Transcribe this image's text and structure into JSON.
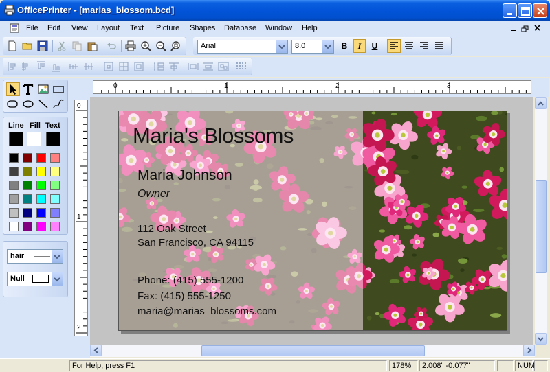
{
  "window": {
    "title": "OfficePrinter - [marias_blossom.bcd]",
    "icon": "printer-app-icon"
  },
  "menu": {
    "items": [
      "File",
      "Edit",
      "View",
      "Layout",
      "Text",
      "Picture",
      "Shapes",
      "Database",
      "Window",
      "Help"
    ]
  },
  "toolbar": {
    "font_name": "Arial",
    "font_size": "8.0",
    "bold_label": "B",
    "italic_label": "I",
    "underline_label": "U",
    "italic_active": true,
    "align_active": "left"
  },
  "tools": {
    "line_label": "Line",
    "fill_label": "Fill",
    "text_label": "Text",
    "line_color": "#000000",
    "fill_color": "#ffffff",
    "text_color": "#000000",
    "palette": [
      "#000000",
      "#800000",
      "#ff0000",
      "#ff8080",
      "#404040",
      "#808000",
      "#ffff00",
      "#ffff80",
      "#808080",
      "#008000",
      "#00ff00",
      "#80ff80",
      "#a0a0a0",
      "#008080",
      "#00ffff",
      "#80ffff",
      "#c0c0c0",
      "#000080",
      "#0000ff",
      "#8080ff",
      "#ffffff",
      "#800080",
      "#ff00ff",
      "#ff80ff"
    ],
    "line_style": "hair",
    "fill_style": "Null"
  },
  "rulers": {
    "h_labels": [
      "0",
      "1",
      "2",
      "3"
    ],
    "v_labels": [
      "0",
      "1",
      "2"
    ]
  },
  "card": {
    "company": "Maria's Blossoms",
    "name": "Maria Johnson",
    "role": "Owner",
    "street": "112 Oak Street",
    "city": "San Francisco, CA 94115",
    "phone": "Phone: (415) 555-1200",
    "fax": "Fax: (415) 555-1250",
    "email": "maria@marias_blossoms.com"
  },
  "status": {
    "help": "For Help, press F1",
    "zoom": "178%",
    "coords": "2.008\" -0.077\"",
    "numlock": "NUM"
  }
}
